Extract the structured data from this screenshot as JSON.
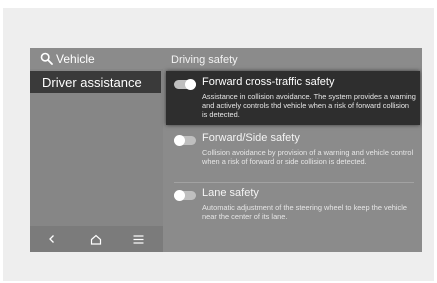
{
  "header": {
    "menu_label": "Vehicle",
    "section_title": "Driving safety"
  },
  "sidebar": {
    "items": [
      {
        "label": "Driver assistance",
        "selected": true
      }
    ]
  },
  "settings": [
    {
      "title": "Forward cross-traffic safety",
      "description": "Assistance in collision avoidance. The system provides a warning and actively controls thd vehicle when a risk of forward collision is detected.",
      "enabled": true,
      "highlighted": true
    },
    {
      "title": "Forward/Side safety",
      "description": "Collision avoidance by provision of a warning and vehicle control when a risk of forward or side collision is detected.",
      "enabled": false,
      "highlighted": false
    },
    {
      "title": "Lane safety",
      "description": "Automatic adjustment of the steering wheel to keep the vehicle near the center of its lane.",
      "enabled": false,
      "highlighted": false
    }
  ],
  "navbar": {
    "icons": [
      "back-icon",
      "home-icon",
      "menu-icon"
    ]
  }
}
